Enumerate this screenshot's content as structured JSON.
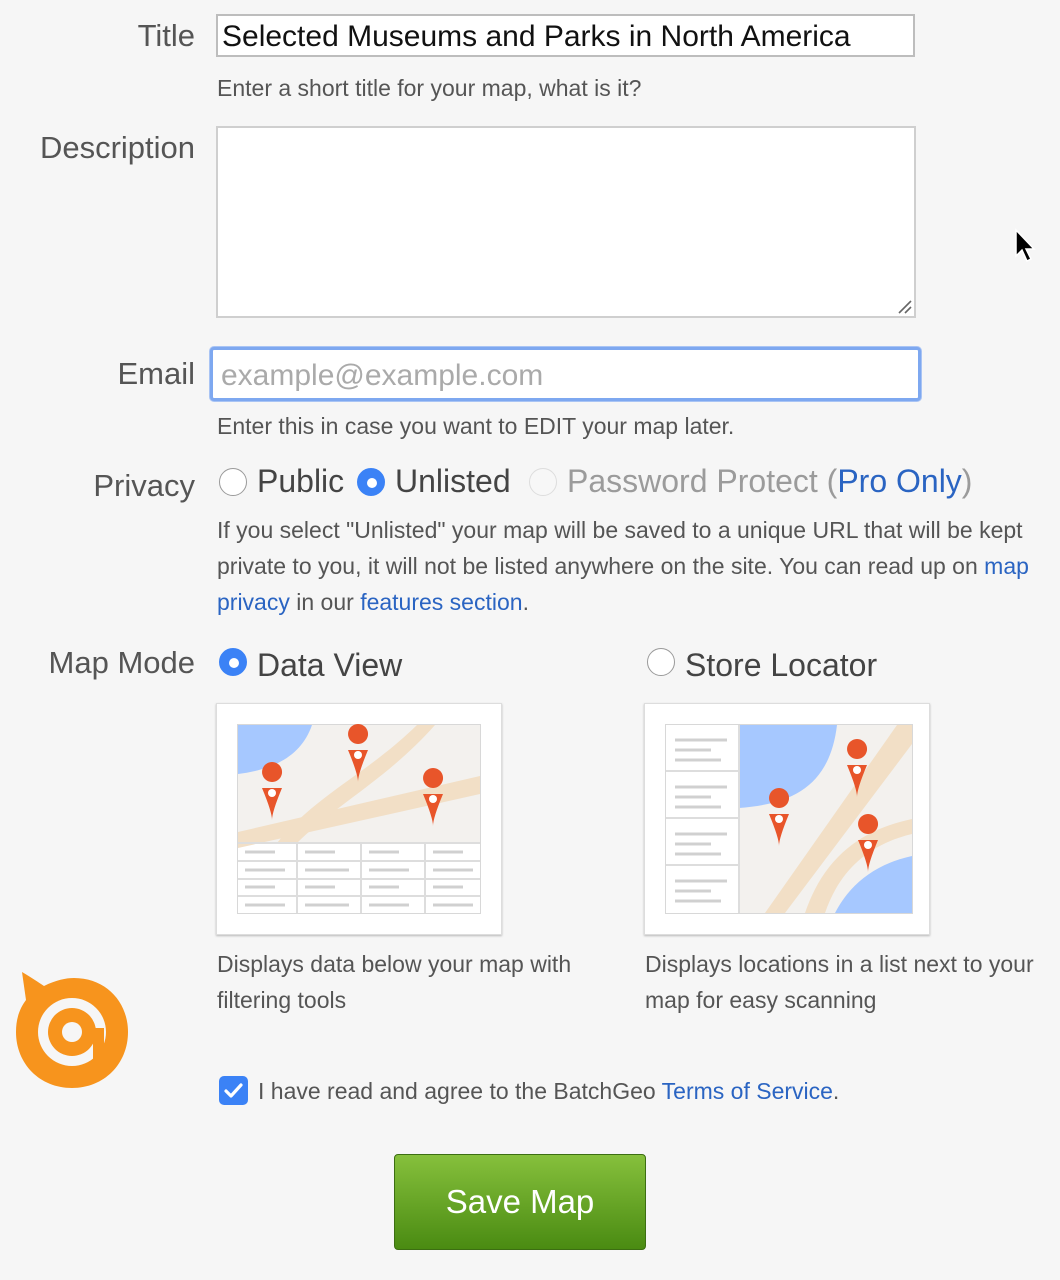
{
  "form": {
    "title": {
      "label": "Title",
      "value": "Selected Museums and Parks in North America",
      "help": "Enter a short title for your map, what is it?"
    },
    "description": {
      "label": "Description",
      "value": ""
    },
    "email": {
      "label": "Email",
      "placeholder": "example@example.com",
      "help": "Enter this in case you want to EDIT your map later."
    },
    "privacy": {
      "label": "Privacy",
      "options": [
        {
          "label": "Public",
          "selected": false
        },
        {
          "label": "Unlisted",
          "selected": true
        },
        {
          "label": "Password Protect",
          "selected": false,
          "disabled": true
        }
      ],
      "paren_open": " (",
      "pro_link": "Pro Only",
      "paren_close": ")",
      "help_part1": "If you select \"Unlisted\" your map will be saved to a unique URL that will be kept private to you, it will not be listed anywhere on the site. You can read up on ",
      "help_link1": "map privacy",
      "help_part2": " in our ",
      "help_link2": "features section",
      "help_part3": "."
    },
    "map_mode": {
      "label": "Map Mode",
      "options": [
        {
          "label": "Data View",
          "selected": true,
          "description": "Displays data below your map with filtering tools"
        },
        {
          "label": "Store Locator",
          "selected": false,
          "description": "Displays locations in a list next to your map for easy scanning"
        }
      ]
    },
    "terms": {
      "checked": true,
      "text": "I have read and agree to the BatchGeo ",
      "link": "Terms of Service",
      "end": "."
    },
    "save_label": "Save Map"
  },
  "colors": {
    "accent": "#3b82f6",
    "link": "#2a64c2",
    "save_button": "#5e9e22",
    "pin": "#e8552a",
    "logo": "#f7941d"
  }
}
